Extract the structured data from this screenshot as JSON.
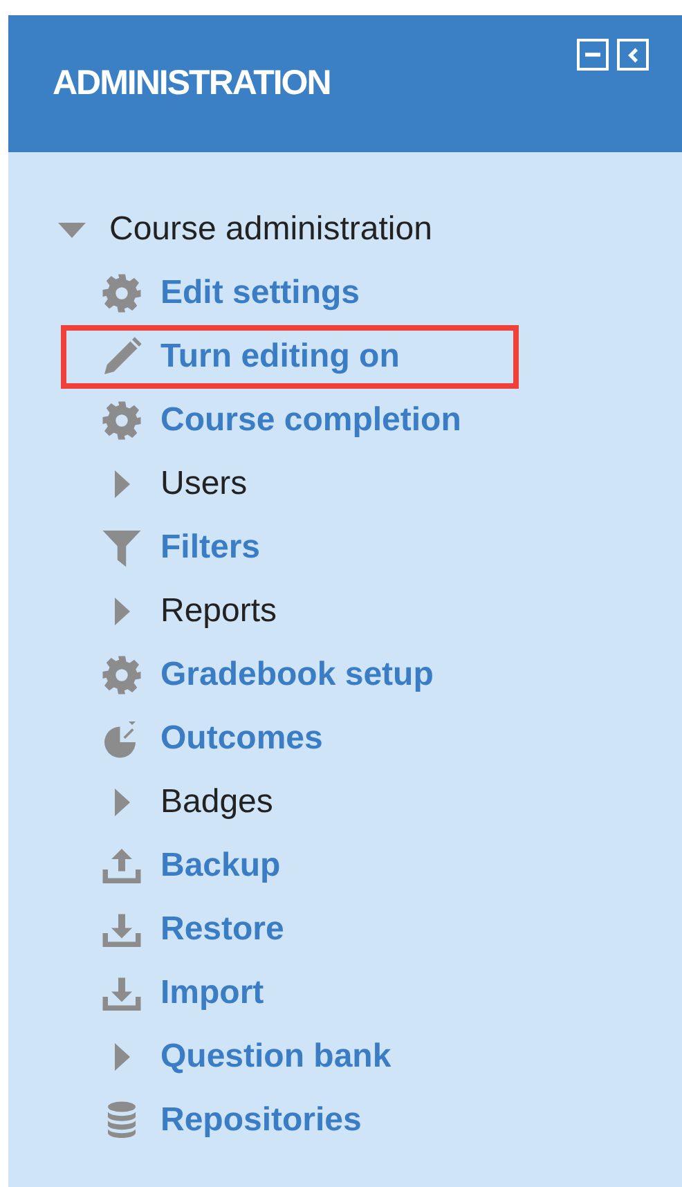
{
  "block": {
    "title": "ADMINISTRATION",
    "controls": [
      {
        "kind": "minimize"
      },
      {
        "kind": "dock"
      }
    ]
  },
  "tree": [
    {
      "label": "Course administration",
      "expanded": true,
      "children": [
        {
          "kind": "setting",
          "label": "Edit settings",
          "highlighted": false
        },
        {
          "kind": "edit",
          "label": "Turn editing on",
          "highlighted": true
        },
        {
          "kind": "setting",
          "label": "Course completion",
          "highlighted": false
        },
        {
          "kind": "branch",
          "label": "Users",
          "expanded": false,
          "highlighted": false
        },
        {
          "kind": "filter",
          "label": "Filters",
          "highlighted": false
        },
        {
          "kind": "branch",
          "label": "Reports",
          "expanded": false,
          "highlighted": false
        },
        {
          "kind": "setting",
          "label": "Gradebook setup",
          "highlighted": false
        },
        {
          "kind": "outcome",
          "label": "Outcomes",
          "highlighted": false
        },
        {
          "kind": "branch",
          "label": "Badges",
          "expanded": false,
          "highlighted": false
        },
        {
          "kind": "upload",
          "label": "Backup",
          "highlighted": false
        },
        {
          "kind": "download",
          "label": "Restore",
          "highlighted": false
        },
        {
          "kind": "download",
          "label": "Import",
          "highlighted": false
        },
        {
          "kind": "linkbranch",
          "label": "Question bank",
          "expanded": false,
          "highlighted": false
        },
        {
          "kind": "repository",
          "label": "Repositories",
          "highlighted": false
        }
      ]
    }
  ]
}
